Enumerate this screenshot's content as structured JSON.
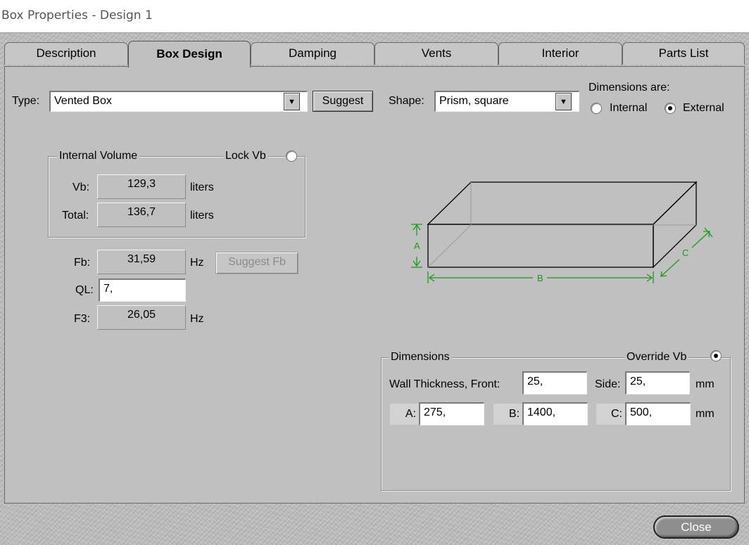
{
  "window": {
    "title": "Box Properties - Design 1"
  },
  "tabs": [
    {
      "label": "Description",
      "active": false
    },
    {
      "label": "Box Design",
      "active": true
    },
    {
      "label": "Damping",
      "active": false
    },
    {
      "label": "Vents",
      "active": false
    },
    {
      "label": "Interior",
      "active": false
    },
    {
      "label": "Parts List",
      "active": false
    }
  ],
  "type": {
    "label": "Type:",
    "value": "Vented Box",
    "suggest_label": "Suggest"
  },
  "shape": {
    "label": "Shape:",
    "value": "Prism, square"
  },
  "dimensions_are": {
    "label": "Dimensions are:",
    "internal_label": "Internal",
    "external_label": "External",
    "selected": "External"
  },
  "internal_volume": {
    "title": "Internal Volume",
    "lock_label": "Lock Vb",
    "vb_label": "Vb:",
    "vb_value": "129,3",
    "vb_unit": "liters",
    "total_label": "Total:",
    "total_value": "136,7",
    "total_unit": "liters"
  },
  "tuning": {
    "fb_label": "Fb:",
    "fb_value": "31,59",
    "fb_unit": "Hz",
    "suggest_fb_label": "Suggest Fb",
    "ql_label": "QL:",
    "ql_value": "7,",
    "f3_label": "F3:",
    "f3_value": "26,05",
    "f3_unit": "Hz"
  },
  "diagram": {
    "a_label": "A",
    "b_label": "B",
    "c_label": "C",
    "dim_color": "#1a9a1a"
  },
  "dimensions": {
    "title": "Dimensions",
    "override_label": "Override Vb",
    "wall_label": "Wall Thickness, Front:",
    "wall_front_value": "25,",
    "side_label": "Side:",
    "side_value": "25,",
    "unit1": "mm",
    "a_label": "A:",
    "a_value": "275,",
    "b_label": "B:",
    "b_value": "1400,",
    "c_label": "C:",
    "c_value": "500,",
    "unit2": "mm"
  },
  "close_label": "Close"
}
